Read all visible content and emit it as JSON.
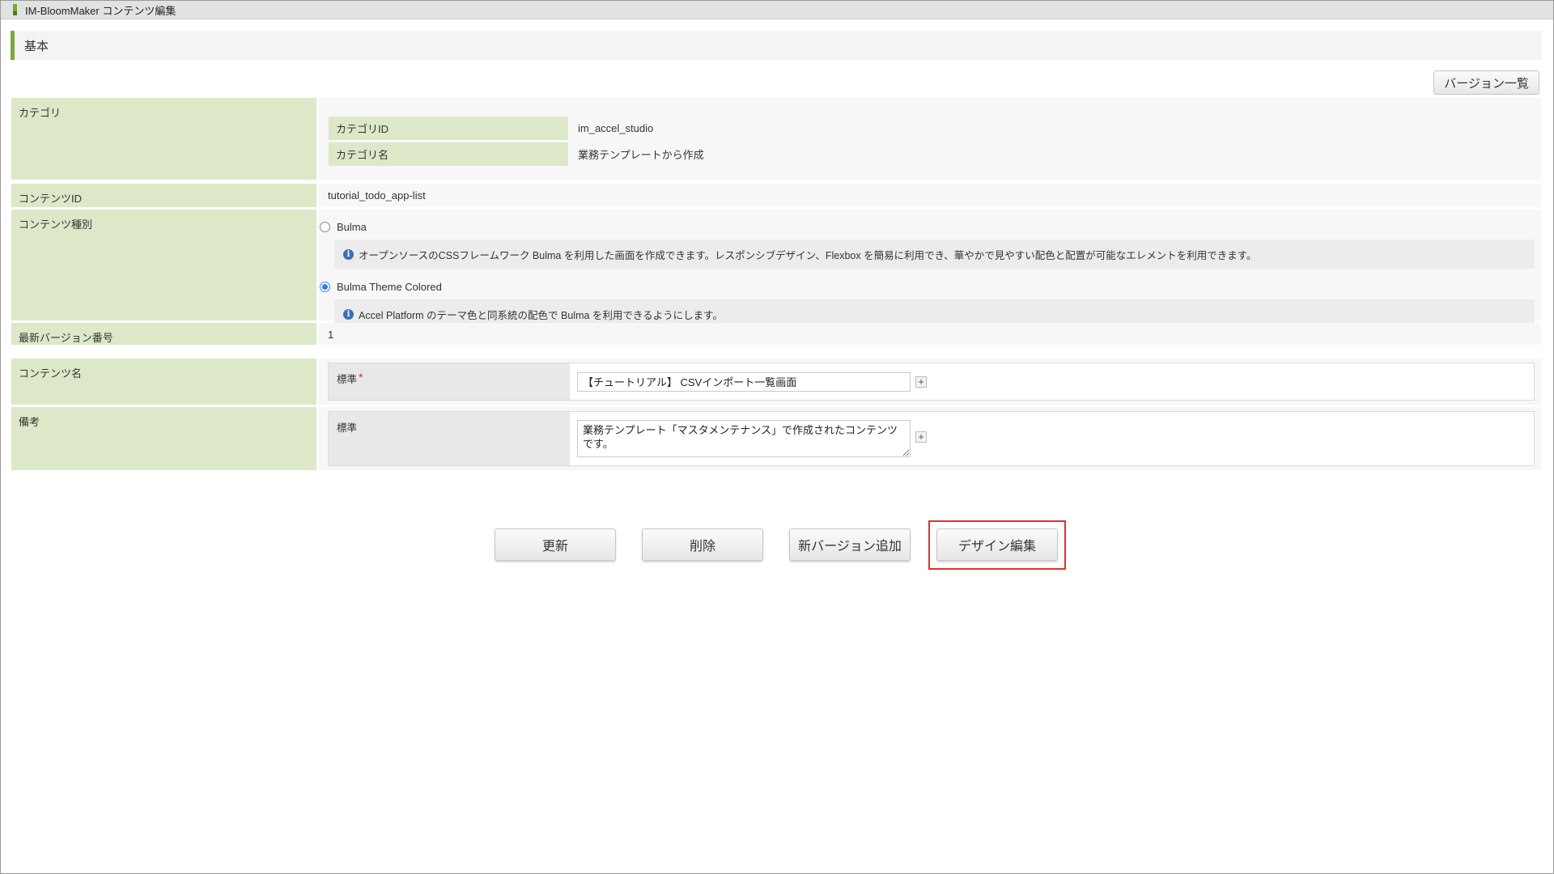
{
  "window": {
    "title": "IM-BloomMaker コンテンツ編集"
  },
  "section": {
    "title": "基本"
  },
  "version_list_button": "バージョン一覧",
  "category": {
    "label": "カテゴリ",
    "id_label": "カテゴリID",
    "id_value": "im_accel_studio",
    "name_label": "カテゴリ名",
    "name_value": "業務テンプレートから作成"
  },
  "content_id": {
    "label": "コンテンツID",
    "value": "tutorial_todo_app-list"
  },
  "content_kind": {
    "label": "コンテンツ種別",
    "options": [
      {
        "label": "Bulma",
        "selected": false,
        "info": "オープンソースのCSSフレームワーク Bulma を利用した画面を作成できます。レスポンシブデザイン、Flexbox を簡易に利用でき、華やかで見やすい配色と配置が可能なエレメントを利用できます。"
      },
      {
        "label": "Bulma Theme Colored",
        "selected": true,
        "info": "Accel Platform のテーマ色と同系統の配色で Bulma を利用できるようにします。"
      }
    ]
  },
  "latest_version": {
    "label": "最新バージョン番号",
    "value": "1"
  },
  "content_name": {
    "label": "コンテンツ名",
    "locale_label": "標準",
    "required_mark": "*",
    "value": "【チュートリアル】 CSVインポート一覧画面"
  },
  "note": {
    "label": "備考",
    "locale_label": "標準",
    "value": "業務テンプレート「マスタメンテナンス」で作成されたコンテンツです。"
  },
  "actions": {
    "update": "更新",
    "delete": "削除",
    "add_version": "新バージョン追加",
    "design_edit": "デザイン編集"
  },
  "colors": {
    "label_bg": "#dde8c8",
    "accent": "#7aa83a",
    "highlight": "#e0302b"
  }
}
